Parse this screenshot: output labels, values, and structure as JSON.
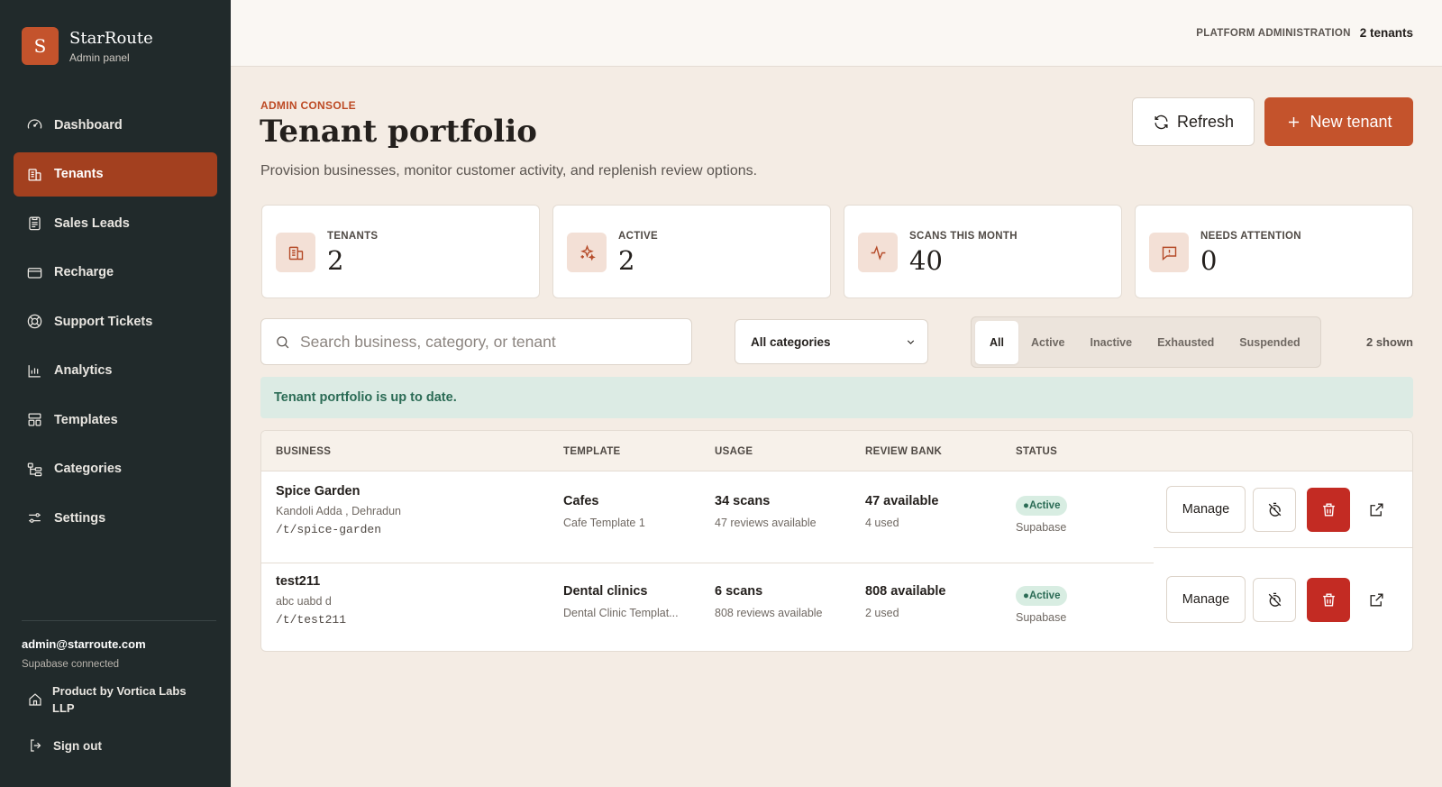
{
  "brand": {
    "initial": "S",
    "name": "StarRoute",
    "subtitle": "Admin panel"
  },
  "sidebar": {
    "items": [
      {
        "label": "Dashboard",
        "icon": "gauge-icon",
        "active": false
      },
      {
        "label": "Tenants",
        "icon": "building-icon",
        "active": true
      },
      {
        "label": "Sales Leads",
        "icon": "clipboard-icon",
        "active": false
      },
      {
        "label": "Recharge",
        "icon": "credit-card-icon",
        "active": false
      },
      {
        "label": "Support Tickets",
        "icon": "lifebuoy-icon",
        "active": false
      },
      {
        "label": "Analytics",
        "icon": "bar-chart-icon",
        "active": false
      },
      {
        "label": "Templates",
        "icon": "layout-icon",
        "active": false
      },
      {
        "label": "Categories",
        "icon": "tree-icon",
        "active": false
      },
      {
        "label": "Settings",
        "icon": "sliders-icon",
        "active": false
      }
    ],
    "email": "admin@starroute.com",
    "connection": "Supabase connected",
    "product_by": "Product by Vortica Labs LLP",
    "sign_out": "Sign out"
  },
  "topbar": {
    "label": "PLATFORM ADMINISTRATION",
    "count": "2 tenants"
  },
  "header": {
    "eyebrow": "ADMIN CONSOLE",
    "title": "Tenant portfolio",
    "subtitle": "Provision businesses, monitor customer activity, and replenish review options.",
    "refresh_label": "Refresh",
    "new_tenant_label": "New tenant"
  },
  "stats": [
    {
      "label": "TENANTS",
      "value": "2",
      "icon": "building-icon"
    },
    {
      "label": "ACTIVE",
      "value": "2",
      "icon": "sparkles-icon"
    },
    {
      "label": "SCANS THIS MONTH",
      "value": "40",
      "icon": "activity-icon"
    },
    {
      "label": "NEEDS ATTENTION",
      "value": "0",
      "icon": "alert-message-icon"
    }
  ],
  "filters": {
    "search_placeholder": "Search business, category, or tenant",
    "category_selected": "All categories",
    "status_tabs": [
      "All",
      "Active",
      "Inactive",
      "Exhausted",
      "Suspended"
    ],
    "active_tab": "All",
    "shown_count": "2 shown"
  },
  "notice": "Tenant portfolio is up to date.",
  "table": {
    "headers": [
      "BUSINESS",
      "TEMPLATE",
      "USAGE",
      "REVIEW BANK",
      "STATUS"
    ],
    "rows": [
      {
        "name": "Spice Garden",
        "location": "Kandoli Adda , Dehradun",
        "slug": "/t/spice-garden",
        "category": "Cafes",
        "template": "Cafe Template 1",
        "scans": "34 scans",
        "reviews_available": "47 reviews available",
        "bank_available": "47 available",
        "bank_used": "4 used",
        "status": "●Active",
        "backend": "Supabase",
        "manage_label": "Manage"
      },
      {
        "name": "test211",
        "location": "abc uabd d",
        "slug": "/t/test211",
        "category": "Dental clinics",
        "template": "Dental Clinic Templat...",
        "scans": "6 scans",
        "reviews_available": "808 reviews available",
        "bank_available": "808 available",
        "bank_used": "2 used",
        "status": "●Active",
        "backend": "Supabase",
        "manage_label": "Manage"
      }
    ]
  }
}
